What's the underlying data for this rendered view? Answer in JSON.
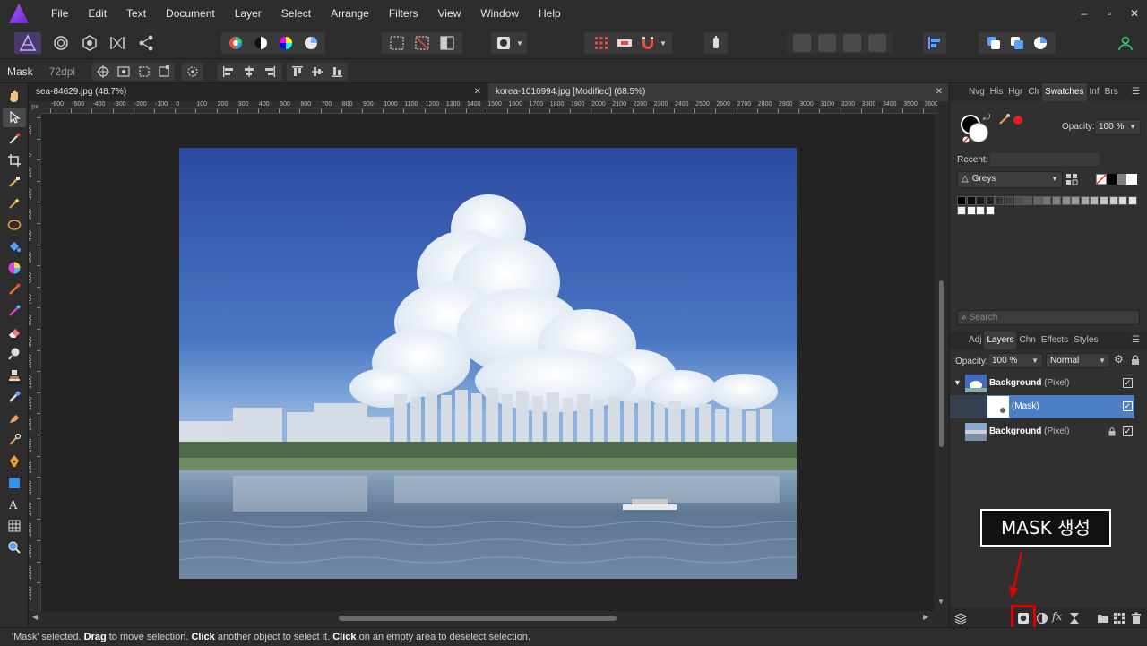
{
  "menubar": {
    "items": [
      "File",
      "Edit",
      "Text",
      "Document",
      "Layer",
      "Select",
      "Arrange",
      "Filters",
      "View",
      "Window",
      "Help"
    ],
    "window_controls": [
      "–",
      "▫",
      "✕"
    ]
  },
  "context_bar": {
    "tool_label": "Mask",
    "dpi": "72dpi"
  },
  "documents": {
    "tabs": [
      {
        "label": "sea-84629.jpg (48.7%)"
      },
      {
        "label": "korea-1016994.jpg [Modified] (68.5%)"
      }
    ],
    "close_glyph": "✕"
  },
  "ruler": {
    "unit": "px",
    "h_labels": [
      "-600",
      "-500",
      "-400",
      "-300",
      "-200",
      "-100",
      "0",
      "100",
      "200",
      "300",
      "400",
      "500",
      "600",
      "700",
      "800",
      "900",
      "1000",
      "1100",
      "1200",
      "1300",
      "1400",
      "1500",
      "1600",
      "1700",
      "1800",
      "1900",
      "2000",
      "2100",
      "2200",
      "2300",
      "2400",
      "2500",
      "2600",
      "2700",
      "2800",
      "2900",
      "3000",
      "3100",
      "3200",
      "3300",
      "3400",
      "3500",
      "3600"
    ],
    "v_labels": [
      "100",
      "0",
      "100",
      "200",
      "300",
      "400",
      "500",
      "600",
      "700",
      "800",
      "900",
      "1000",
      "1100",
      "1200",
      "1300",
      "1400",
      "1500",
      "1600",
      "1700",
      "1800",
      "1900",
      "2000",
      "2100"
    ]
  },
  "swatches_panel": {
    "tabs": [
      "Nvg",
      "His",
      "Hgr",
      "Clr",
      "Swatches",
      "Inf",
      "Brs"
    ],
    "active_tab": "Swatches",
    "opacity_label": "Opacity:",
    "opacity_value": "100 %",
    "recent_label": "Recent:",
    "palette": "Greys",
    "grey_swatches": [
      "#000000",
      "#0d0d0d",
      "#1a1a1a",
      "#262626",
      "#333333",
      "#404040",
      "#4d4d4d",
      "#595959",
      "#666666",
      "#737373",
      "#808080",
      "#8c8c8c",
      "#999999",
      "#a6a6a6",
      "#b3b3b3",
      "#bfbfbf",
      "#cccccc",
      "#d9d9d9",
      "#e6e6e6",
      "#f2f2f2",
      "#f7f7f7",
      "#fafafa",
      "#ffffff"
    ],
    "search_placeholder": "Search"
  },
  "layers_panel": {
    "tabs": [
      "Adj",
      "Layers",
      "Chn",
      "Effects",
      "Styles"
    ],
    "active_tab": "Layers",
    "opacity_label": "Opacity:",
    "opacity_value": "100 %",
    "blend_mode": "Normal",
    "layers": [
      {
        "name": "Background",
        "type": "(Pixel)",
        "expanded": true,
        "visible": true,
        "locked": false
      },
      {
        "name": "(Mask)",
        "type": "",
        "selected": true,
        "visible": true,
        "locked": false
      },
      {
        "name": "Background",
        "type": "(Pixel)",
        "visible": true,
        "locked": true
      }
    ]
  },
  "annotation": {
    "callout_text": "MASK 생성",
    "color": "#e00000"
  },
  "statusbar": {
    "parts": [
      {
        "text": "'Mask' selected. ",
        "bold": false
      },
      {
        "text": "Drag",
        "bold": true
      },
      {
        "text": " to move selection. ",
        "bold": false
      },
      {
        "text": "Click",
        "bold": true
      },
      {
        "text": " another object to select it. ",
        "bold": false
      },
      {
        "text": "Click",
        "bold": true
      },
      {
        "text": " on an empty area to deselect selection.",
        "bold": false
      }
    ]
  }
}
